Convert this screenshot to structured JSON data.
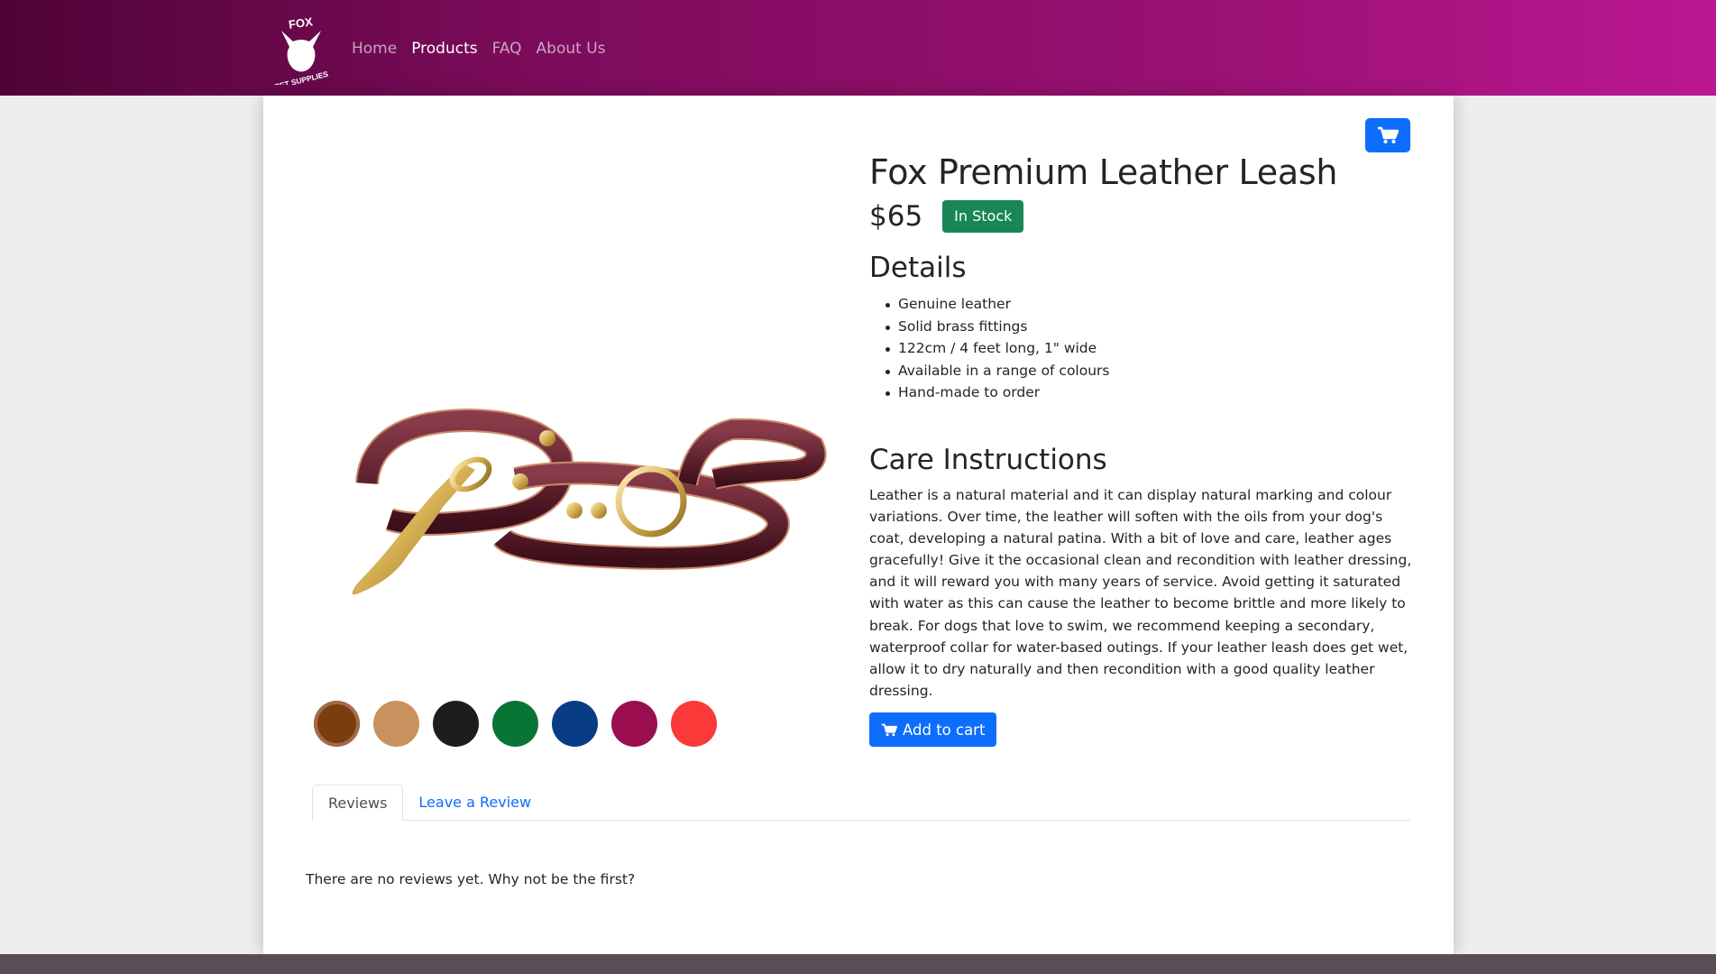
{
  "brand": {
    "logo_text_top": "FOX",
    "logo_text_bottom": "PET SUPPLIES"
  },
  "nav": {
    "items": [
      {
        "label": "Home",
        "active": false
      },
      {
        "label": "Products",
        "active": true
      },
      {
        "label": "FAQ",
        "active": false
      },
      {
        "label": "About Us",
        "active": false
      }
    ]
  },
  "cart_button": {
    "icon": "shopping-cart-icon"
  },
  "product": {
    "title": "Fox Premium Leather Leash",
    "price": "$65",
    "stock_badge": "In Stock",
    "details_heading": "Details",
    "details": [
      "Genuine leather",
      "Solid brass fittings",
      "122cm / 4 feet long, 1\" wide",
      "Available in a range of colours",
      "Hand-made to order"
    ],
    "care_heading": "Care Instructions",
    "care_text": "Leather is a natural material and it can display natural marking and colour variations. Over time, the leather will soften with the oils from your dog's coat, developing a natural patina. With a bit of love and care, leather ages gracefully! Give it the occasional clean and recondition with leather dressing, and it will reward you with many years of service. Avoid getting it saturated with water as this can cause the leather to become brittle and more likely to break. For dogs that love to swim, we recommend keeping a secondary, waterproof collar for water-based outings. If your leather leash does get wet, allow it to dry naturally and then recondition with a good quality leather dressing.",
    "add_to_cart_label": "Add to cart",
    "colour_swatches": [
      {
        "color": "#7a3d10",
        "selected": true
      },
      {
        "color": "#c8915e",
        "selected": false
      },
      {
        "color": "#1d1d1d",
        "selected": false
      },
      {
        "color": "#097535",
        "selected": false
      },
      {
        "color": "#083d86",
        "selected": false
      },
      {
        "color": "#9a0e4f",
        "selected": false
      },
      {
        "color": "#fb3939",
        "selected": false
      }
    ]
  },
  "tabs": {
    "items": [
      {
        "label": "Reviews",
        "active": true
      },
      {
        "label": "Leave a Review",
        "active": false
      }
    ],
    "empty_message": "There are no reviews yet. Why not be the first?"
  },
  "colors": {
    "primary": "#0d6efd",
    "success": "#198754",
    "nav_gradient_start": "#4f0337",
    "nav_gradient_end": "#bb1792"
  }
}
